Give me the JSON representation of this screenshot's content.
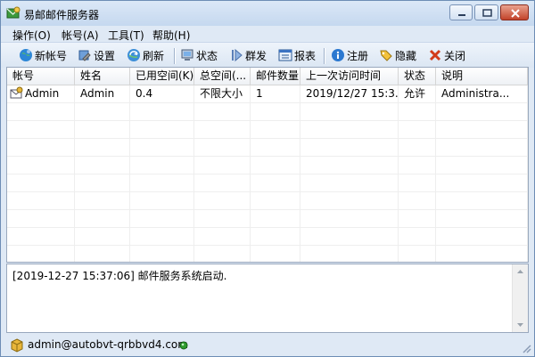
{
  "window": {
    "title": "易邮邮件服务器"
  },
  "menu": [
    {
      "label": "操作(O)"
    },
    {
      "label": "帐号(A)"
    },
    {
      "label": "工具(T)"
    },
    {
      "label": "帮助(H)"
    }
  ],
  "toolbar": {
    "new_account": "新帐号",
    "settings": "设置",
    "refresh": "刷新",
    "status": "状态",
    "bulk_send": "群发",
    "report": "报表",
    "register": "注册",
    "hide": "隐藏",
    "close": "关闭"
  },
  "table": {
    "columns": [
      "帐号",
      "姓名",
      "已用空间(K)",
      "总空间(...",
      "邮件数量",
      "上一次访问时间",
      "状态",
      "说明"
    ],
    "rows": [
      {
        "account": "Admin",
        "name": "Admin",
        "used_space": "0.4",
        "total_space": "不限大小",
        "mail_count": "1",
        "last_access": "2019/12/27 15:3...",
        "status": "允许",
        "description": "Administra..."
      }
    ]
  },
  "log": {
    "line": "[2019-12-27 15:37:06] 邮件服务系统启动."
  },
  "statusbar": {
    "text": "admin@autobvt-qrbbvd4.com"
  },
  "colors": {
    "window_bg": "#dfe9f5",
    "close_button": "#c2432a",
    "status_led": "#2e9c2e"
  }
}
